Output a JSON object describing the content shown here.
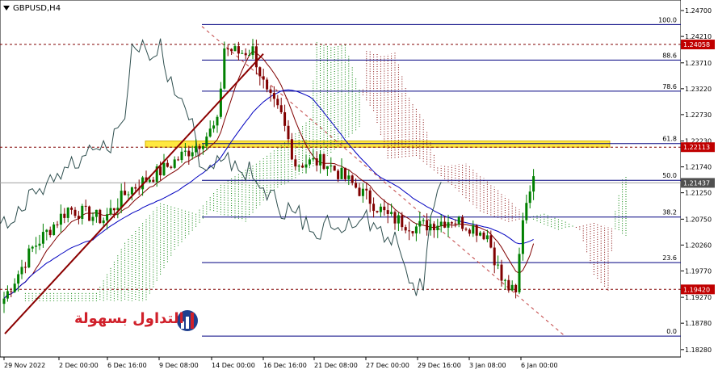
{
  "header": {
    "symbol": "GBPUSD,H4"
  },
  "logo": {
    "text": "التداول بسهولة"
  },
  "chart_data": {
    "type": "candlestick",
    "symbol": "GBPUSD",
    "timeframe": "H4",
    "ylim": [
      1.1814,
      1.249
    ],
    "y_ticks": [
      "1.24700",
      "1.24210",
      "1.23710",
      "1.23220",
      "1.22730",
      "1.22230",
      "1.21740",
      "1.21250",
      "1.20750",
      "1.20260",
      "1.19770",
      "1.19270",
      "1.18780",
      "1.18280"
    ],
    "x_ticks": [
      "29 Nov 2022",
      "2 Dec 00:00",
      "6 Dec 16:00",
      "9 Dec 08:00",
      "14 Dec 00:00",
      "16 Dec 16:00",
      "21 Dec 08:00",
      "27 Dec 00:00",
      "29 Dec 16:00",
      "3 Jan 08:00",
      "6 Jan 00:00"
    ],
    "price_tags": [
      {
        "label": "1.24058",
        "value": 1.24058,
        "color": "#c00000"
      },
      {
        "label": "1.22113",
        "value": 1.22113,
        "color": "#c00000"
      },
      {
        "label": "1.21437",
        "value": 1.21437,
        "color": "#505050"
      },
      {
        "label": "1.19420",
        "value": 1.1942,
        "color": "#c00000"
      }
    ],
    "fibonacci": [
      {
        "label": "100.0",
        "value": 1.24435
      },
      {
        "label": "88.6",
        "value": 1.23763
      },
      {
        "label": "78.6",
        "value": 1.23173
      },
      {
        "label": "61.8",
        "value": 1.22182
      },
      {
        "label": "50.0",
        "value": 1.21486
      },
      {
        "label": "38.2",
        "value": 1.2079
      },
      {
        "label": "23.6",
        "value": 1.19928
      },
      {
        "label": "0.0",
        "value": 1.18535
      }
    ],
    "horizontal_lines": [
      1.24058,
      1.22113,
      1.1942
    ],
    "highlight_zone": {
      "from": 1.22113,
      "to": 1.2223,
      "color": "#ffe000"
    },
    "colors": {
      "bull": "#008000",
      "bear": "#800000",
      "kijun": "#0000c0",
      "chikou": "#2f4f4f",
      "cloud_bull": "#008000",
      "cloud_bear": "#800000",
      "trendline": "#8b0000",
      "fib": "#000080"
    }
  }
}
